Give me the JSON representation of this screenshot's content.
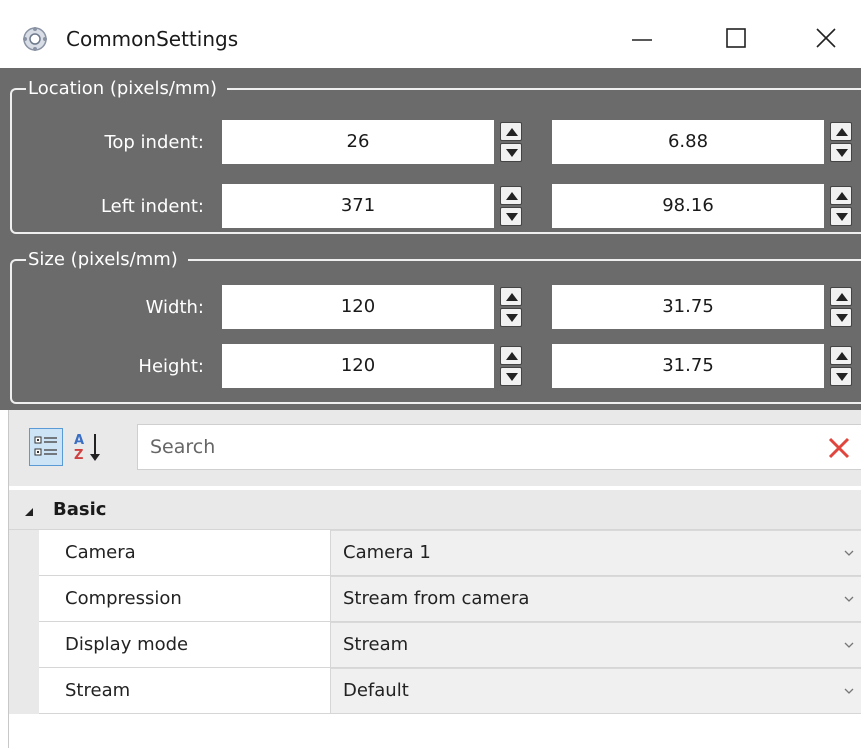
{
  "window": {
    "title": "CommonSettings",
    "icon": "app-settings-icon",
    "controls": [
      "minimize-icon",
      "maximize-icon",
      "close-icon"
    ]
  },
  "location": {
    "legend": "Location (pixels/mm)",
    "rows": [
      {
        "label": "Top indent:",
        "pixels": "26",
        "mm": "6.88"
      },
      {
        "label": "Left indent:",
        "pixels": "371",
        "mm": "98.16"
      }
    ]
  },
  "size": {
    "legend": "Size (pixels/mm)",
    "rows": [
      {
        "label": "Width:",
        "pixels": "120",
        "mm": "31.75"
      },
      {
        "label": "Height:",
        "pixels": "120",
        "mm": "31.75"
      }
    ]
  },
  "toolbar": {
    "categorized_icon": "categorized-view-icon",
    "sort_icon": "sort-az-icon",
    "search_placeholder": "Search",
    "clear_icon": "clear-search-icon"
  },
  "properties": {
    "category": "Basic",
    "items": [
      {
        "name": "Camera",
        "value": "Camera 1"
      },
      {
        "name": "Compression",
        "value": "Stream from camera"
      },
      {
        "name": "Display mode",
        "value": "Stream"
      },
      {
        "name": "Stream",
        "value": "Default"
      }
    ]
  },
  "colors": {
    "panel": "#6b6b6b",
    "clear_x": "#e0463e"
  }
}
